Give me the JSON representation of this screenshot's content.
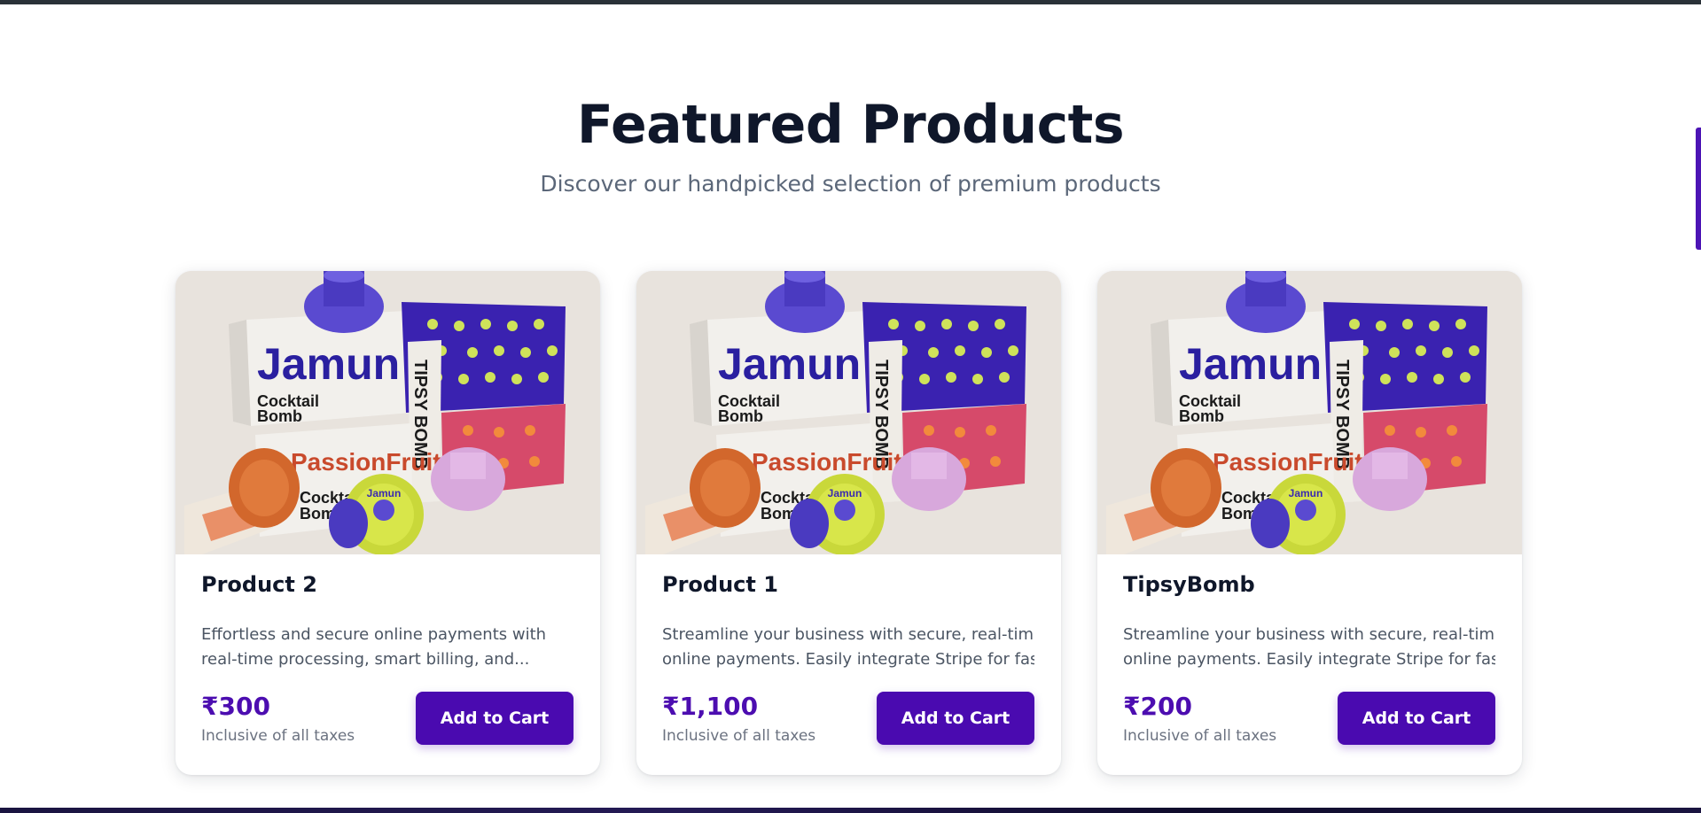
{
  "section": {
    "title": "Featured Products",
    "subtitle": "Discover our handpicked selection of premium products"
  },
  "products": [
    {
      "name": "Product 2",
      "description_lines": [
        "Effortless and secure online payments with",
        "real-time processing, smart billing, and..."
      ],
      "price": "₹300",
      "tax_note": "Inclusive of all taxes",
      "button_label": "Add to Cart",
      "image_text": {
        "brand1": "Jamun",
        "brand2": "PassionFruit",
        "line1": "Cocktail",
        "line2": "Bomb",
        "side": "TIPSY BOMB",
        "cap": "Jamun"
      }
    },
    {
      "name": "Product 1",
      "description_lines": [
        "Streamline your business with secure, real-time",
        "online payments. Easily integrate Stripe for fas..."
      ],
      "price": "₹1,100",
      "tax_note": "Inclusive of all taxes",
      "button_label": "Add to Cart",
      "image_text": {
        "brand1": "Jamun",
        "brand2": "PassionFruit",
        "line1": "Cocktail",
        "line2": "Bomb",
        "side": "TIPSY BOMB",
        "cap": "Jamun"
      }
    },
    {
      "name": "TipsyBomb",
      "description_lines": [
        "Streamline your business with secure, real-time",
        "online payments. Easily integrate Stripe for fas..."
      ],
      "price": "₹200",
      "tax_note": "Inclusive of all taxes",
      "button_label": "Add to Cart",
      "image_text": {
        "brand1": "Jamun",
        "brand2": "PassionFruit",
        "line1": "Cocktail",
        "line2": "Bomb",
        "side": "TIPSY BOMB",
        "cap": "Jamun"
      }
    }
  ],
  "colors": {
    "accent": "#4a0ab0",
    "price": "#4c0db0",
    "heading": "#0f172a",
    "subtitle": "#5b6779"
  }
}
